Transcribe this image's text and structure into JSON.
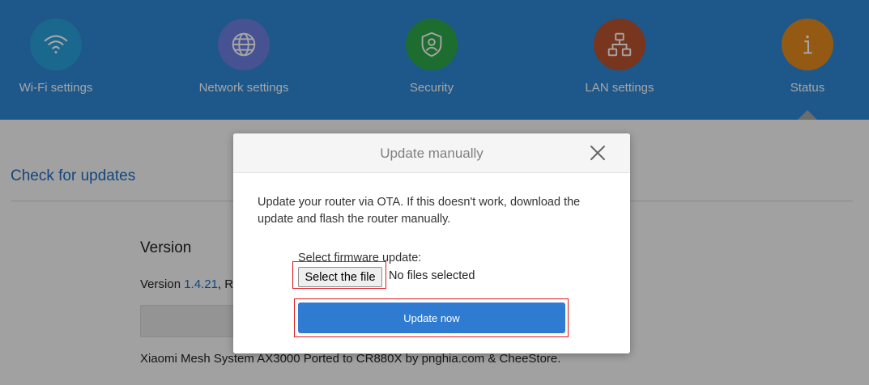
{
  "nav": {
    "items": [
      {
        "id": "wifi",
        "label": "Wi-Fi settings",
        "icon": "wifi-icon",
        "color": "#2aa0dc"
      },
      {
        "id": "network",
        "label": "Network settings",
        "icon": "globe-icon",
        "color": "#6e7fe0"
      },
      {
        "id": "security",
        "label": "Security",
        "icon": "shield-user-icon",
        "color": "#2ea84a"
      },
      {
        "id": "lan",
        "label": "LAN settings",
        "icon": "network-topology-icon",
        "color": "#b8532e"
      },
      {
        "id": "status",
        "label": "Status",
        "icon": "info-icon",
        "color": "#e38a1e",
        "active": true
      }
    ]
  },
  "page": {
    "title": "Check for updates",
    "version_heading": "Version",
    "version_prefix": "Version ",
    "version_number": "1.4.21",
    "version_suffix": ", Ro",
    "footer_note": "Xiaomi Mesh System AX3000 Ported to CR880X by pnghia.com & CheeStore."
  },
  "modal": {
    "title": "Update manually",
    "close_icon": "close-icon",
    "description": "Update your router via OTA. If this doesn't work, download the update and flash the router manually.",
    "firmware_label": "Select firmware update:",
    "file_button_label": "Select the file",
    "file_status": "No files selected",
    "update_button_label": "Update now"
  },
  "colors": {
    "nav_background": "#2f86d3",
    "accent_blue": "#2f7bd1",
    "highlight_red": "#e0161c"
  }
}
